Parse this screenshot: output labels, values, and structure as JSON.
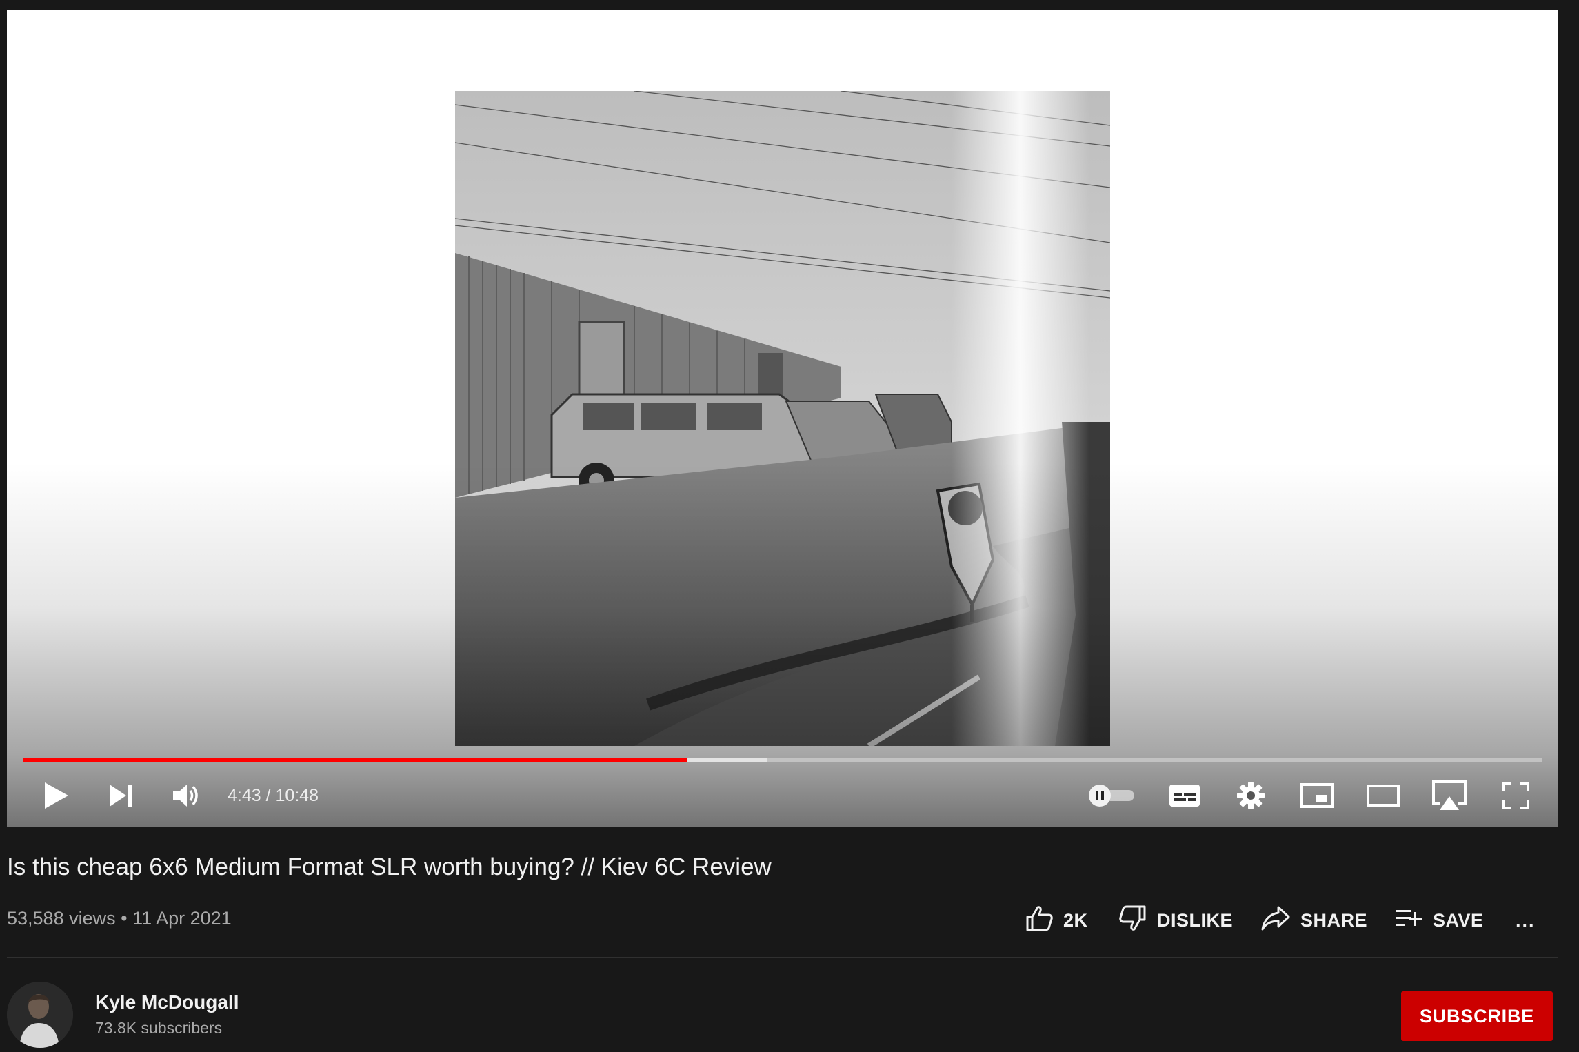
{
  "player": {
    "time_current": "4:43",
    "time_separator": " / ",
    "time_total": "10:48",
    "progress_played": 0.437,
    "progress_buffered": 0.49,
    "progress_color": "#ff0000",
    "controls": {
      "play_icon": "play-icon",
      "next_icon": "next-icon",
      "volume_icon": "volume-icon",
      "autoplay_icon": "autoplay-toggle-icon",
      "captions_icon": "captions-icon",
      "settings_icon": "settings-gear-icon",
      "miniplayer_icon": "miniplayer-icon",
      "theater_icon": "theater-mode-icon",
      "airplay_icon": "airplay-icon",
      "fullscreen_icon": "fullscreen-icon"
    }
  },
  "video": {
    "title": "Is this cheap 6x6 Medium Format SLR worth buying? // Kiev 6C Review",
    "views": "53,588 views",
    "separator": " • ",
    "date": "11 Apr 2021"
  },
  "actions": {
    "like_count": "2K",
    "dislike_label": "DISLIKE",
    "share_label": "SHARE",
    "save_label": "SAVE",
    "more_label": "..."
  },
  "channel": {
    "name": "Kyle McDougall",
    "subscribers": "73.8K subscribers",
    "subscribe_label": "SUBSCRIBE",
    "subscribe_color": "#cc0000"
  }
}
